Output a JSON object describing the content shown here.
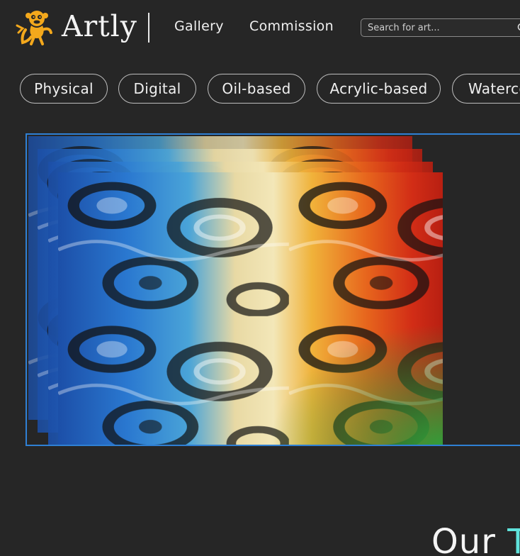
{
  "header": {
    "brand": "Artly",
    "logo_icon": "monkey-logo-icon",
    "nav": [
      {
        "label": "Gallery"
      },
      {
        "label": "Commission"
      }
    ],
    "search": {
      "placeholder": "Search for art...",
      "value": "",
      "icon": "search-icon"
    }
  },
  "categories": [
    {
      "label": "Physical"
    },
    {
      "label": "Digital"
    },
    {
      "label": "Oil-based"
    },
    {
      "label": "Acrylic-based"
    },
    {
      "label": "Waterco"
    }
  ],
  "gallery": {
    "image_subject": "abstract swirling colorful painting",
    "stacked_images": 5
  },
  "section": {
    "title_lead": "Our",
    "title_accent": "T"
  },
  "colors": {
    "background": "#262626",
    "accent_border": "#2f80d4",
    "accent_text": "#5fe3dc",
    "logo": "#f3a81c"
  }
}
